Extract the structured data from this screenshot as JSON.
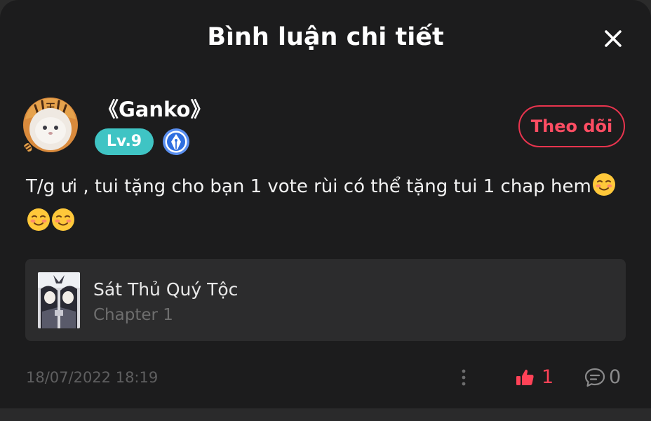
{
  "header": {
    "title": "Bình luận chi tiết"
  },
  "user": {
    "name": "《Ganko》",
    "level": "Lv.9",
    "follow_label": "Theo dõi"
  },
  "comment": {
    "text": "T/g ưi , tui tặng cho bạn 1 vote rùi có thể tặng tui 1 chap hem"
  },
  "manga": {
    "title": "Sát Thủ Quý Tộc",
    "chapter": "Chapter 1"
  },
  "footer": {
    "timestamp": "18/07/2022 18:19",
    "like_count": "1",
    "reply_count": "0"
  },
  "colors": {
    "accent": "#ff4257",
    "level_badge": "#3fc4c4",
    "background": "#1c1c1d",
    "card": "#2c2c2d"
  },
  "icons": {
    "close": "close-icon",
    "badge": "pen-nib-badge-icon",
    "emoji": "smiling-blush-emoji",
    "more": "more-vertical-icon",
    "like": "thumbs-up-icon",
    "reply": "comment-bubble-icon"
  }
}
